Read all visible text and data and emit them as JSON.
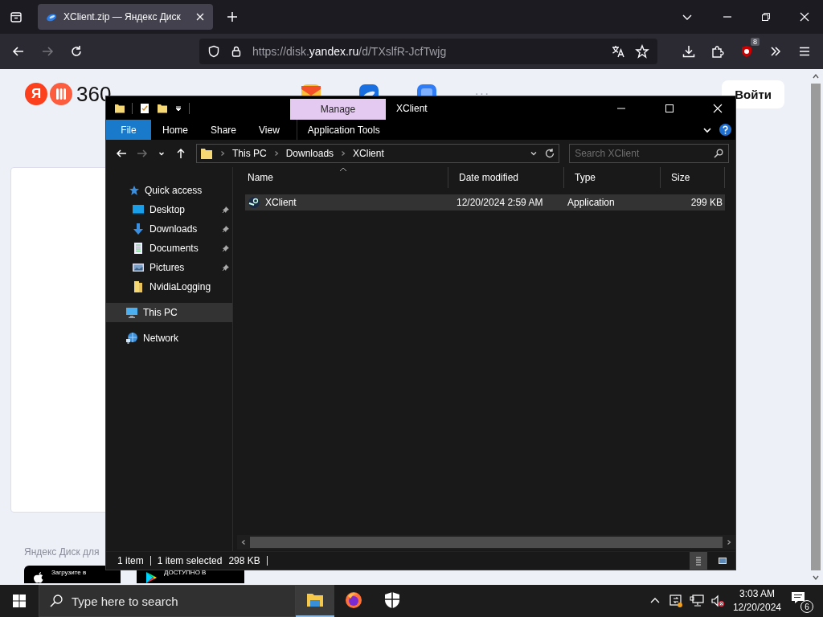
{
  "browser": {
    "tabs": [
      {
        "title": "XClient.zip — Яндекс Диск",
        "selected": true
      }
    ],
    "back_disabled": false,
    "forward_disabled": true,
    "url": {
      "scheme": "https://disk.",
      "domain": "yandex.ru",
      "path": "/d/TXslfR-JcfTwjg"
    },
    "extension_badge": "8"
  },
  "page": {
    "logo": {
      "letter": "Я",
      "number": "360"
    },
    "more": "···",
    "login": "Войти",
    "footer_text": "Яндекс Диск для",
    "store_badges": [
      {
        "kind": "apple",
        "caption": "Загрузите в"
      },
      {
        "kind": "google",
        "caption": "ДОСТУПНО В"
      }
    ]
  },
  "explorer": {
    "title": "XClient",
    "context_tab": "Manage",
    "ribbon_tabs": [
      {
        "label": "File",
        "selected": true
      },
      {
        "label": "Home",
        "selected": false
      },
      {
        "label": "Share",
        "selected": false
      },
      {
        "label": "View",
        "selected": false
      },
      {
        "label": "Application Tools",
        "selected": false
      }
    ],
    "breadcrumb": [
      "This PC",
      "Downloads",
      "XClient"
    ],
    "search": {
      "placeholder": "Search XClient"
    },
    "nav": [
      {
        "label": "Quick access",
        "kind": "star",
        "selected": false,
        "children": [
          {
            "label": "Desktop",
            "kind": "desktop",
            "selected": false,
            "pinned": true
          },
          {
            "label": "Downloads",
            "kind": "download",
            "selected": false,
            "pinned": true
          },
          {
            "label": "Documents",
            "kind": "document",
            "selected": false,
            "pinned": true
          },
          {
            "label": "Pictures",
            "kind": "picture",
            "selected": false,
            "pinned": true
          },
          {
            "label": "NvidiaLogging",
            "kind": "folder",
            "selected": false,
            "pinned": false
          }
        ]
      },
      {
        "label": "This PC",
        "kind": "pc",
        "selected": true
      },
      {
        "label": "Network",
        "kind": "network",
        "selected": false
      }
    ],
    "columns": [
      {
        "label": "Name",
        "sorted": true
      },
      {
        "label": "Date modified",
        "sorted": false
      },
      {
        "label": "Type",
        "sorted": false
      },
      {
        "label": "Size",
        "sorted": false
      }
    ],
    "rows": [
      {
        "name": "XClient",
        "date": "12/20/2024 2:59 AM",
        "type": "Application",
        "size": "299 KB",
        "selected": true
      }
    ],
    "status": {
      "count": "1 item",
      "selection": "1 item selected",
      "size": "298 KB"
    },
    "views": [
      {
        "kind": "details",
        "selected": true
      },
      {
        "kind": "large-icons",
        "selected": false
      }
    ]
  },
  "taskbar": {
    "search": {
      "placeholder": "Type here to search"
    },
    "apps": [
      {
        "kind": "explorer",
        "active": true
      },
      {
        "kind": "firefox",
        "active": false
      },
      {
        "kind": "shield",
        "active": false
      }
    ],
    "tray": [
      {
        "kind": "sync"
      },
      {
        "kind": "network"
      },
      {
        "kind": "volume-muted"
      }
    ],
    "time": "3:03 AM",
    "date": "12/20/2024",
    "notifications": "6"
  }
}
